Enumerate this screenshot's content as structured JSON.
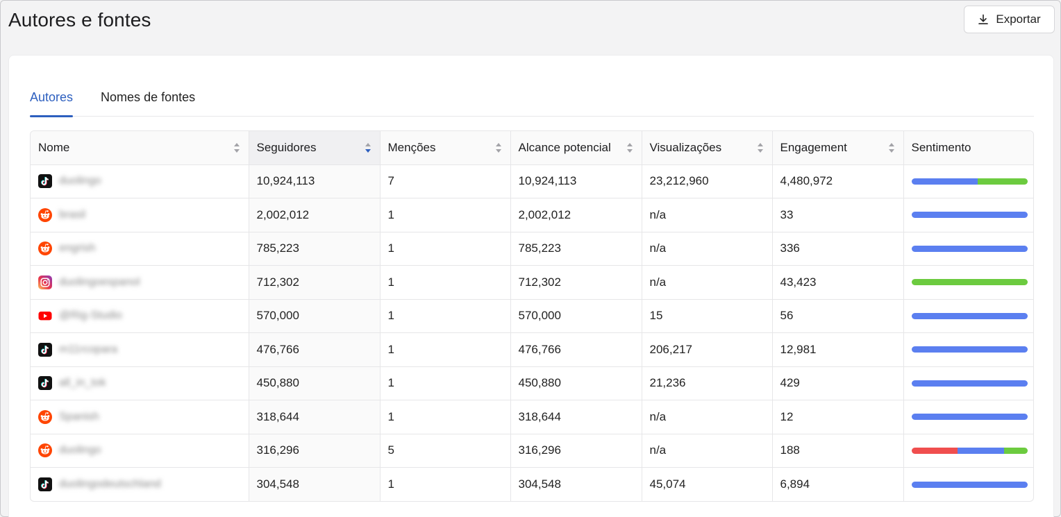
{
  "header": {
    "title": "Autores e fontes",
    "export_label": "Exportar"
  },
  "tabs": [
    {
      "label": "Autores",
      "active": true
    },
    {
      "label": "Nomes de fontes",
      "active": false
    }
  ],
  "table": {
    "columns": [
      "Nome",
      "Seguidores",
      "Menções",
      "Alcance potencial",
      "Visualizações",
      "Engagement",
      "Sentimento"
    ],
    "sorted_column": "Seguidores",
    "sort_direction": "desc",
    "rows": [
      {
        "source": "tiktok-icon",
        "name": "duolingo",
        "seguidores": "10,924,113",
        "mencoes": "7",
        "alcance": "10,924,113",
        "visualizacoes": "23,212,960",
        "engagement": "4,480,972",
        "sentiment": {
          "negative": 0,
          "neutral": 0.57,
          "positive": 0.43
        }
      },
      {
        "source": "reddit-icon",
        "name": "brasil",
        "seguidores": "2,002,012",
        "mencoes": "1",
        "alcance": "2,002,012",
        "visualizacoes": "n/a",
        "engagement": "33",
        "sentiment": {
          "negative": 0,
          "neutral": 1,
          "positive": 0
        }
      },
      {
        "source": "reddit-icon",
        "name": "engrish",
        "seguidores": "785,223",
        "mencoes": "1",
        "alcance": "785,223",
        "visualizacoes": "n/a",
        "engagement": "336",
        "sentiment": {
          "negative": 0,
          "neutral": 1,
          "positive": 0
        }
      },
      {
        "source": "instagram-icon",
        "name": "duolingoespanol",
        "seguidores": "712,302",
        "mencoes": "1",
        "alcance": "712,302",
        "visualizacoes": "n/a",
        "engagement": "43,423",
        "sentiment": {
          "negative": 0,
          "neutral": 0,
          "positive": 1
        }
      },
      {
        "source": "youtube-icon",
        "name": "@Rig-Studio",
        "seguidores": "570,000",
        "mencoes": "1",
        "alcance": "570,000",
        "visualizacoes": "15",
        "engagement": "56",
        "sentiment": {
          "negative": 0,
          "neutral": 1,
          "positive": 0
        }
      },
      {
        "source": "tiktok-icon",
        "name": "m11rcopara",
        "seguidores": "476,766",
        "mencoes": "1",
        "alcance": "476,766",
        "visualizacoes": "206,217",
        "engagement": "12,981",
        "sentiment": {
          "negative": 0,
          "neutral": 1,
          "positive": 0
        }
      },
      {
        "source": "tiktok-icon",
        "name": "all_in_tok",
        "seguidores": "450,880",
        "mencoes": "1",
        "alcance": "450,880",
        "visualizacoes": "21,236",
        "engagement": "429",
        "sentiment": {
          "negative": 0,
          "neutral": 1,
          "positive": 0
        }
      },
      {
        "source": "reddit-icon",
        "name": "Spanish",
        "seguidores": "318,644",
        "mencoes": "1",
        "alcance": "318,644",
        "visualizacoes": "n/a",
        "engagement": "12",
        "sentiment": {
          "negative": 0,
          "neutral": 1,
          "positive": 0
        }
      },
      {
        "source": "reddit-icon",
        "name": "duolingo",
        "seguidores": "316,296",
        "mencoes": "5",
        "alcance": "316,296",
        "visualizacoes": "n/a",
        "engagement": "188",
        "sentiment": {
          "negative": 0.4,
          "neutral": 0.4,
          "positive": 0.2
        }
      },
      {
        "source": "tiktok-icon",
        "name": "duolingodeutschland",
        "seguidores": "304,548",
        "mencoes": "1",
        "alcance": "304,548",
        "visualizacoes": "45,074",
        "engagement": "6,894",
        "sentiment": {
          "negative": 0,
          "neutral": 1,
          "positive": 0
        }
      }
    ]
  },
  "colors": {
    "accent": "#2d5fbf",
    "sentiment_negative": "#f04e4e",
    "sentiment_neutral": "#5b7ff0",
    "sentiment_positive": "#6ccb3f"
  }
}
